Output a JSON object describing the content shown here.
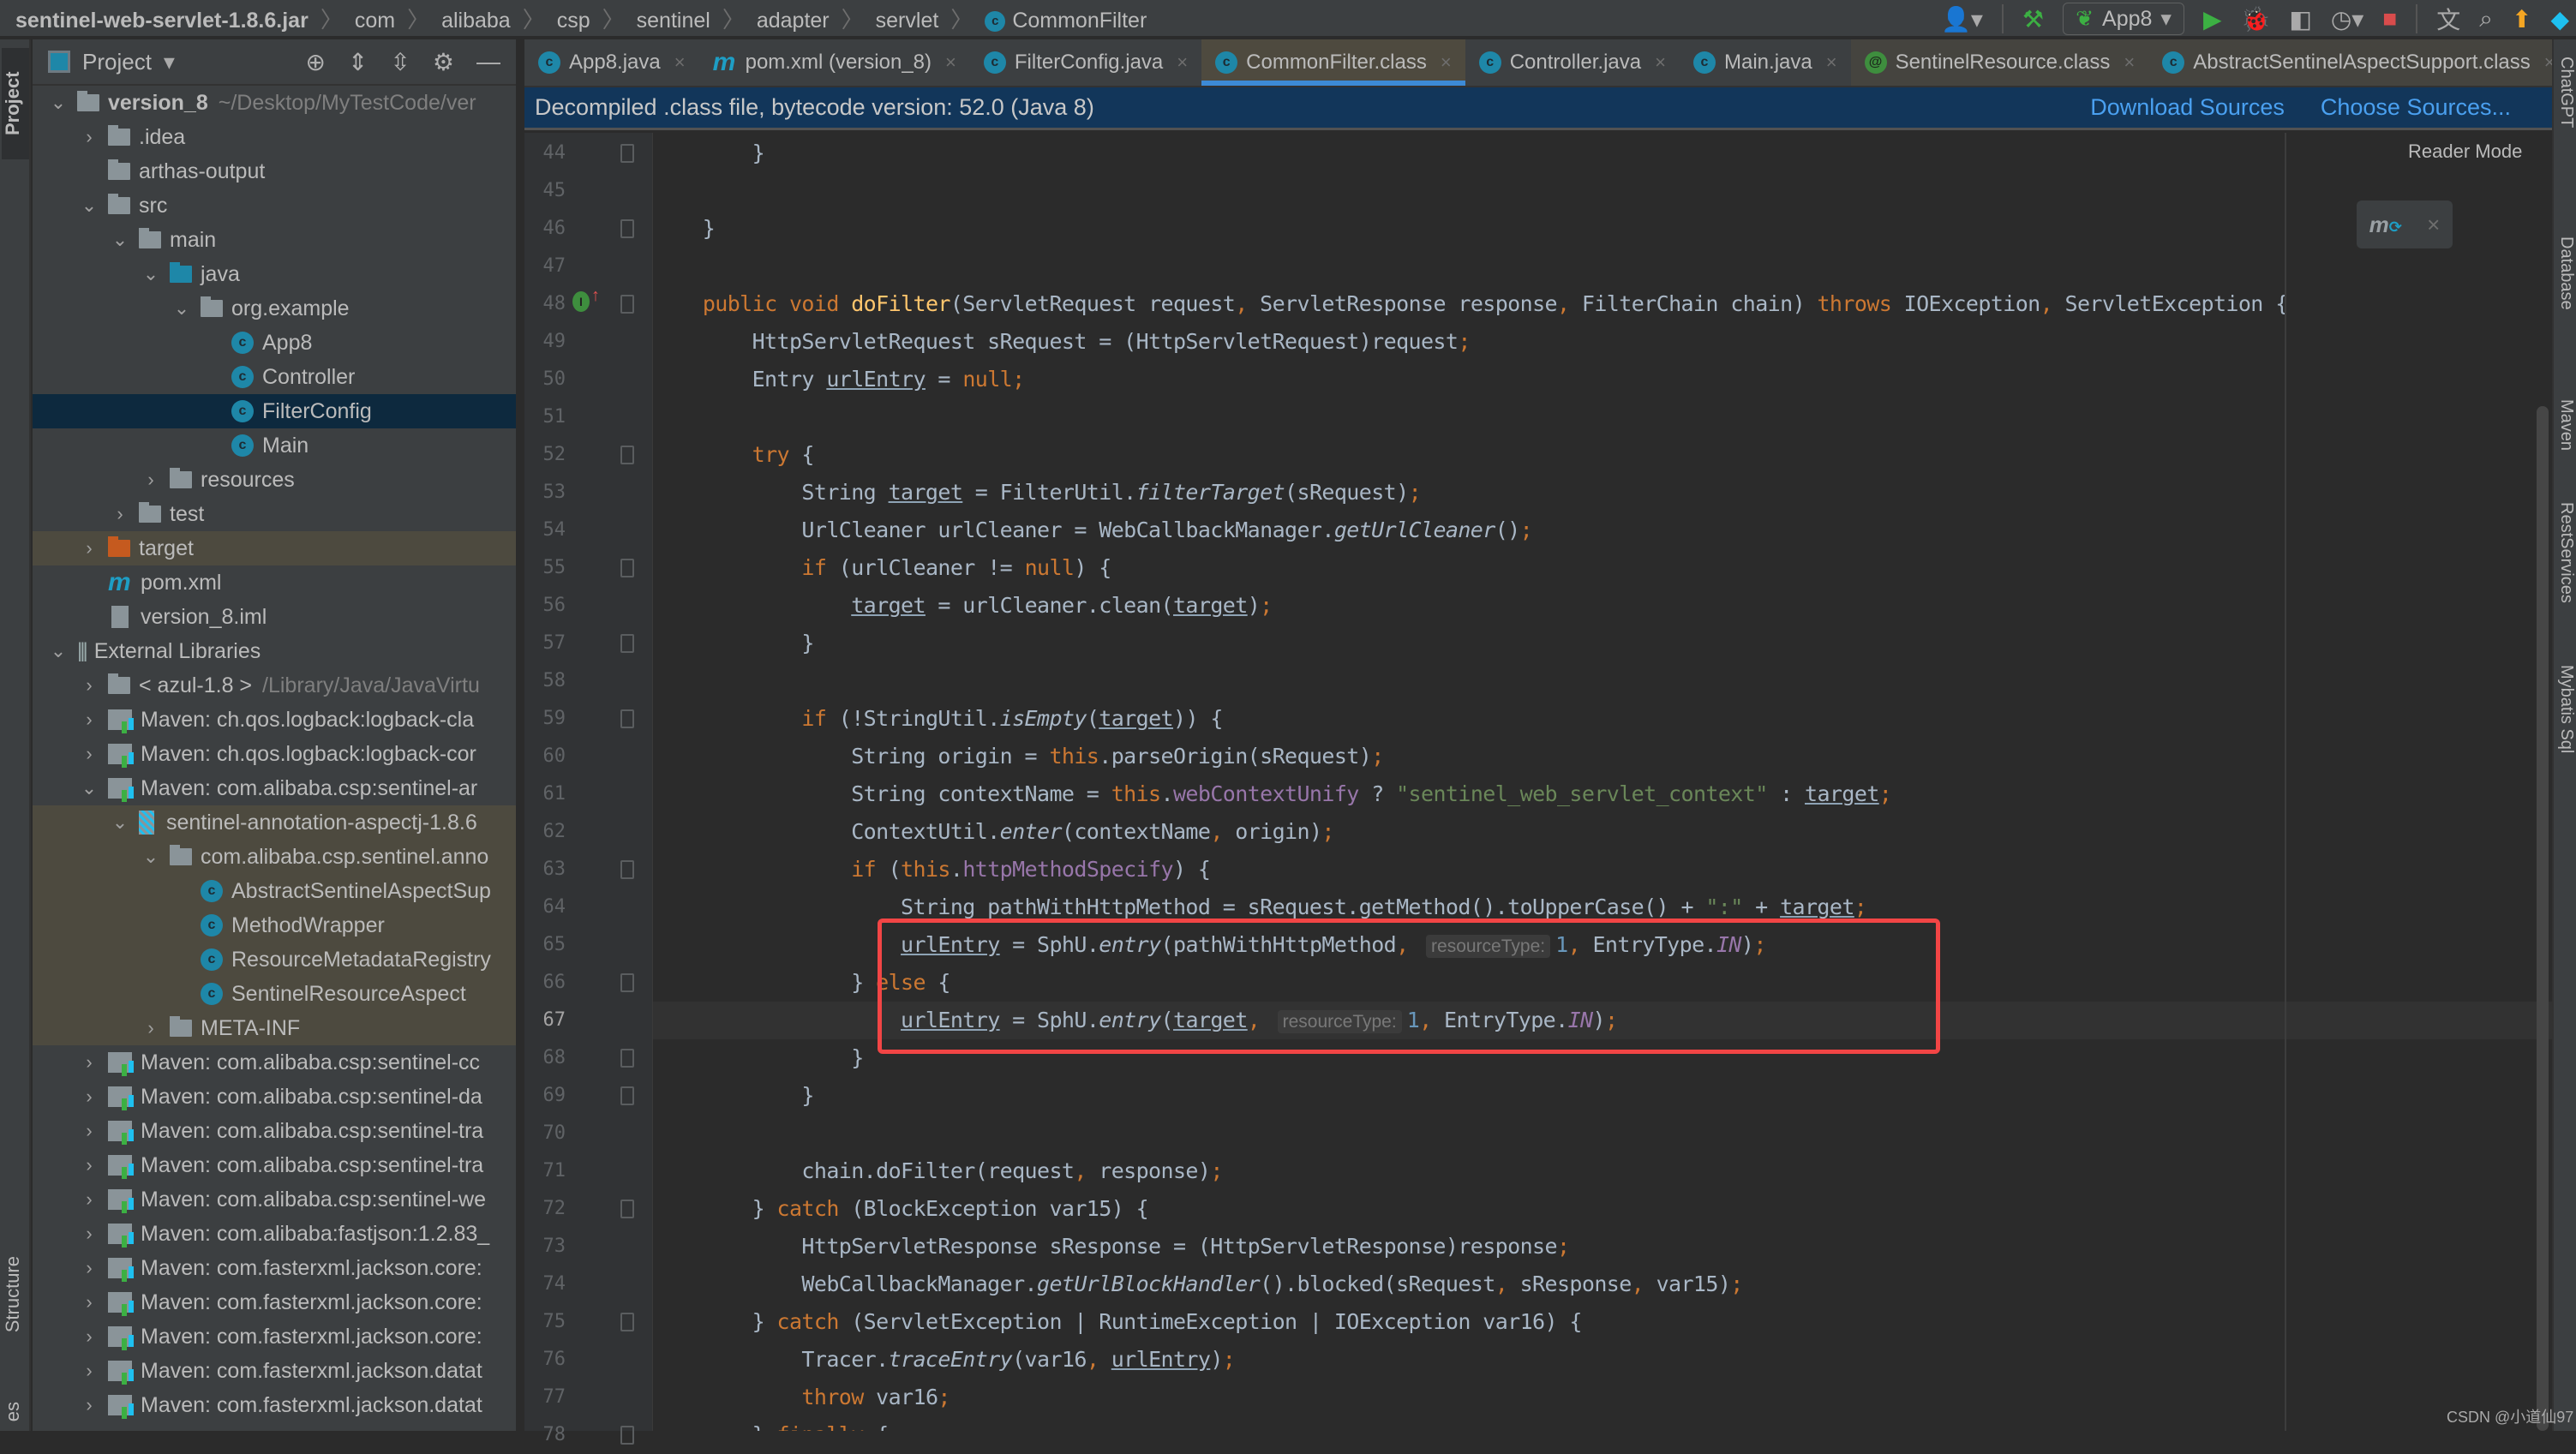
{
  "breadcrumb": [
    "sentinel-web-servlet-1.8.6.jar",
    "com",
    "alibaba",
    "csp",
    "sentinel",
    "adapter",
    "servlet",
    "CommonFilter"
  ],
  "toolbar": {
    "run_config": "App8",
    "icons": [
      "user-icon",
      "build-hammer-icon",
      "run-icon",
      "debug-icon",
      "coverage-icon",
      "profile-icon",
      "stop-icon",
      "translate-icon",
      "search-icon",
      "update-icon",
      "plugin-icon"
    ]
  },
  "left_stripe": {
    "project_tab": "Project",
    "structure_tab": "Structure",
    "bottom_tab": "es"
  },
  "project_panel": {
    "title": "Project",
    "tree": [
      {
        "label": "version_8",
        "extra": "~/Desktop/MyTestCode/ver",
        "depth": 0,
        "chev": "open",
        "icon": "module",
        "bold": true
      },
      {
        "label": ".idea",
        "depth": 1,
        "chev": "closed",
        "icon": "folder"
      },
      {
        "label": "arthas-output",
        "depth": 1,
        "chev": "none",
        "icon": "folder"
      },
      {
        "label": "src",
        "depth": 1,
        "chev": "open",
        "icon": "folder"
      },
      {
        "label": "main",
        "depth": 2,
        "chev": "open",
        "icon": "folder"
      },
      {
        "label": "java",
        "depth": 3,
        "chev": "open",
        "icon": "folder-blue"
      },
      {
        "label": "org.example",
        "depth": 4,
        "chev": "open",
        "icon": "package"
      },
      {
        "label": "App8",
        "depth": 5,
        "chev": "none",
        "icon": "class"
      },
      {
        "label": "Controller",
        "depth": 5,
        "chev": "none",
        "icon": "class"
      },
      {
        "label": "FilterConfig",
        "depth": 5,
        "chev": "none",
        "icon": "class",
        "state": "selected"
      },
      {
        "label": "Main",
        "depth": 5,
        "chev": "none",
        "icon": "class"
      },
      {
        "label": "resources",
        "depth": 3,
        "chev": "closed",
        "icon": "folder"
      },
      {
        "label": "test",
        "depth": 2,
        "chev": "closed",
        "icon": "folder"
      },
      {
        "label": "target",
        "depth": 1,
        "chev": "closed",
        "icon": "folder-orange",
        "state": "excluded"
      },
      {
        "label": "pom.xml",
        "depth": 1,
        "chev": "none",
        "icon": "maven"
      },
      {
        "label": "version_8.iml",
        "depth": 1,
        "chev": "none",
        "icon": "file"
      },
      {
        "label": "External Libraries",
        "depth": 0,
        "chev": "open",
        "icon": "bars"
      },
      {
        "label": "< azul-1.8 >",
        "extra": "/Library/Java/JavaVirtu",
        "depth": 1,
        "chev": "closed",
        "icon": "folder"
      },
      {
        "label": "Maven: ch.qos.logback:logback-cla",
        "depth": 1,
        "chev": "closed",
        "icon": "lib"
      },
      {
        "label": "Maven: ch.qos.logback:logback-cor",
        "depth": 1,
        "chev": "closed",
        "icon": "lib"
      },
      {
        "label": "Maven: com.alibaba.csp:sentinel-ar",
        "depth": 1,
        "chev": "open",
        "icon": "lib"
      },
      {
        "label": "sentinel-annotation-aspectj-1.8.6",
        "depth": 2,
        "chev": "open",
        "icon": "jar",
        "state": "lib-hl"
      },
      {
        "label": "com.alibaba.csp.sentinel.anno",
        "depth": 3,
        "chev": "open",
        "icon": "folder",
        "state": "lib-hl"
      },
      {
        "label": "AbstractSentinelAspectSup",
        "depth": 4,
        "chev": "none",
        "icon": "class",
        "state": "lib-hl"
      },
      {
        "label": "MethodWrapper",
        "depth": 4,
        "chev": "none",
        "icon": "class",
        "state": "lib-hl"
      },
      {
        "label": "ResourceMetadataRegistry",
        "depth": 4,
        "chev": "none",
        "icon": "class",
        "state": "lib-hl"
      },
      {
        "label": "SentinelResourceAspect",
        "depth": 4,
        "chev": "none",
        "icon": "class",
        "state": "lib-hl"
      },
      {
        "label": "META-INF",
        "depth": 3,
        "chev": "closed",
        "icon": "folder",
        "state": "lib-hl"
      },
      {
        "label": "Maven: com.alibaba.csp:sentinel-cc",
        "depth": 1,
        "chev": "closed",
        "icon": "lib"
      },
      {
        "label": "Maven: com.alibaba.csp:sentinel-da",
        "depth": 1,
        "chev": "closed",
        "icon": "lib"
      },
      {
        "label": "Maven: com.alibaba.csp:sentinel-tra",
        "depth": 1,
        "chev": "closed",
        "icon": "lib"
      },
      {
        "label": "Maven: com.alibaba.csp:sentinel-tra",
        "depth": 1,
        "chev": "closed",
        "icon": "lib"
      },
      {
        "label": "Maven: com.alibaba.csp:sentinel-we",
        "depth": 1,
        "chev": "closed",
        "icon": "lib"
      },
      {
        "label": "Maven: com.alibaba:fastjson:1.2.83_",
        "depth": 1,
        "chev": "closed",
        "icon": "lib"
      },
      {
        "label": "Maven: com.fasterxml.jackson.core:",
        "depth": 1,
        "chev": "closed",
        "icon": "lib"
      },
      {
        "label": "Maven: com.fasterxml.jackson.core:",
        "depth": 1,
        "chev": "closed",
        "icon": "lib"
      },
      {
        "label": "Maven: com.fasterxml.jackson.core:",
        "depth": 1,
        "chev": "closed",
        "icon": "lib"
      },
      {
        "label": "Maven: com.fasterxml.jackson.datat",
        "depth": 1,
        "chev": "closed",
        "icon": "lib"
      },
      {
        "label": "Maven: com.fasterxml.jackson.datat",
        "depth": 1,
        "chev": "closed",
        "icon": "lib"
      }
    ]
  },
  "tabs": [
    {
      "label": "App8.java",
      "icon": "class-run"
    },
    {
      "label": "pom.xml (version_8)",
      "icon": "maven"
    },
    {
      "label": "FilterConfig.java",
      "icon": "class"
    },
    {
      "label": "CommonFilter.class",
      "icon": "class-locked",
      "active": true
    },
    {
      "label": "Controller.java",
      "icon": "class"
    },
    {
      "label": "Main.java",
      "icon": "class-run"
    },
    {
      "label": "SentinelResource.class",
      "icon": "annotation-locked",
      "dim": true
    },
    {
      "label": "AbstractSentinelAspectSupport.class",
      "icon": "abstract-class-locked",
      "dim": true
    }
  ],
  "banner": {
    "text": "Decompiled .class file, bytecode version: 52.0 (Java 8)",
    "download_sources": "Download Sources",
    "choose_sources": "Choose Sources..."
  },
  "editor": {
    "reader_mode": "Reader Mode",
    "current_line": 67,
    "lines": [
      {
        "n": 44,
        "html": "        }"
      },
      {
        "n": 45,
        "html": ""
      },
      {
        "n": 46,
        "html": "    }"
      },
      {
        "n": 47,
        "html": ""
      },
      {
        "n": 48,
        "html": "    <span class=\"kw\">public void</span> <span class=\"fn\">doFilter</span>(ServletRequest request<span class=\"kw\">,</span> ServletResponse response<span class=\"kw\">,</span> FilterChain chain) <span class=\"kw\">throws</span> IOException<span class=\"kw\">,</span> ServletException {"
      },
      {
        "n": 49,
        "html": "        HttpServletRequest sRequest = (HttpServletRequest)request<span class=\"kw\">;</span>"
      },
      {
        "n": 50,
        "html": "        Entry <span class=\"ul\">urlEntry</span> = <span class=\"kw\">null;</span>"
      },
      {
        "n": 51,
        "html": ""
      },
      {
        "n": 52,
        "html": "        <span class=\"kw\">try</span> {"
      },
      {
        "n": 53,
        "html": "            String <span class=\"ul\">target</span> = FilterUtil.<span class=\"it\">filterTarget</span>(sRequest)<span class=\"kw\">;</span>"
      },
      {
        "n": 54,
        "html": "            UrlCleaner urlCleaner = WebCallbackManager.<span class=\"it\">getUrlCleaner</span>()<span class=\"kw\">;</span>"
      },
      {
        "n": 55,
        "html": "            <span class=\"kw\">if</span> (urlCleaner != <span class=\"kw\">null</span>) {"
      },
      {
        "n": 56,
        "html": "                <span class=\"ul\">target</span> = urlCleaner.clean(<span class=\"ul\">target</span>)<span class=\"kw\">;</span>"
      },
      {
        "n": 57,
        "html": "            }"
      },
      {
        "n": 58,
        "html": ""
      },
      {
        "n": 59,
        "html": "            <span class=\"kw\">if</span> (!StringUtil.<span class=\"it\">isEmpty</span>(<span class=\"ul\">target</span>)) {"
      },
      {
        "n": 60,
        "html": "                String origin = <span class=\"kw\">this</span>.parseOrigin(sRequest)<span class=\"kw\">;</span>"
      },
      {
        "n": 61,
        "html": "                String contextName = <span class=\"kw\">this</span>.<span class=\"fld\">webContextUnify</span> ? <span class=\"str\">\"sentinel_web_servlet_context\"</span> : <span class=\"ul\">target</span><span class=\"kw\">;</span>"
      },
      {
        "n": 62,
        "html": "                ContextUtil.<span class=\"it\">enter</span>(contextName<span class=\"kw\">,</span> origin)<span class=\"kw\">;</span>"
      },
      {
        "n": 63,
        "html": "                <span class=\"kw\">if</span> (<span class=\"kw\">this</span>.<span class=\"fld\">httpMethodSpecify</span>) {"
      },
      {
        "n": 64,
        "html": "                    String pathWithHttpMethod = sRequest.getMethod().toUpperCase() + <span class=\"str\">\":\"</span> + <span class=\"ul\">target</span><span class=\"kw\">;</span>"
      },
      {
        "n": 65,
        "html": "                    <span class=\"ul\">urlEntry</span> = SphU.<span class=\"it\">entry</span>(pathWithHttpMethod<span class=\"kw\">,</span> <span class=\"hint\">resourceType:</span><span class=\"num\">1</span><span class=\"kw\">,</span> EntryType.<span class=\"fld it\">IN</span>)<span class=\"kw\">;</span>"
      },
      {
        "n": 66,
        "html": "                } <span class=\"kw\">else</span> {"
      },
      {
        "n": 67,
        "html": "                    <span class=\"ul\">urlEntry</span> = SphU.<span class=\"it\">entry</span>(<span class=\"ul\">target</span><span class=\"kw\">,</span> <span class=\"hint\">resourceType:</span><span class=\"num\">1</span><span class=\"kw\">,</span> EntryType.<span class=\"fld it\">IN</span>)<span class=\"kw\">;</span>"
      },
      {
        "n": 68,
        "html": "                }"
      },
      {
        "n": 69,
        "html": "            }"
      },
      {
        "n": 70,
        "html": ""
      },
      {
        "n": 71,
        "html": "            chain.doFilter(request<span class=\"kw\">,</span> response)<span class=\"kw\">;</span>"
      },
      {
        "n": 72,
        "html": "        } <span class=\"kw\">catch</span> (BlockException var15) {"
      },
      {
        "n": 73,
        "html": "            HttpServletResponse sResponse = (HttpServletResponse)response<span class=\"kw\">;</span>"
      },
      {
        "n": 74,
        "html": "            WebCallbackManager.<span class=\"it\">getUrlBlockHandler</span>().blocked(sRequest<span class=\"kw\">,</span> sResponse<span class=\"kw\">,</span> var15)<span class=\"kw\">;</span>"
      },
      {
        "n": 75,
        "html": "        } <span class=\"kw\">catch</span> (ServletException | RuntimeException | IOException var16) {"
      },
      {
        "n": 76,
        "html": "            Tracer.<span class=\"it\">traceEntry</span>(var16<span class=\"kw\">,</span> <span class=\"ul\">urlEntry</span>)<span class=\"kw\">;</span>"
      },
      {
        "n": 77,
        "html": "            <span class=\"kw\">throw</span> var16<span class=\"kw\">;</span>"
      },
      {
        "n": 78,
        "html": "        } <span class=\"kw\">finally</span> {"
      }
    ],
    "fold_lines": [
      44,
      46,
      48,
      52,
      55,
      57,
      59,
      63,
      66,
      68,
      69,
      72,
      75,
      78
    ]
  },
  "right_stripe": [
    "ChatGPT",
    "Database",
    "Maven",
    "RestServices",
    "Mybatis Sql"
  ],
  "watermark": "CSDN @小道仙97",
  "colors": {
    "keyword": "#cc7832",
    "method_decl": "#ffc66d",
    "field": "#9876aa",
    "string": "#6a8759",
    "number": "#6897bb",
    "highlight_box": "#f24545",
    "selection": "#0d293e",
    "banner_bg": "#12365a",
    "link": "#4aa0f0"
  }
}
